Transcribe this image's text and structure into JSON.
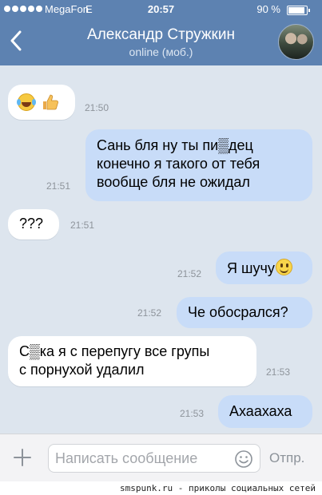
{
  "status_bar": {
    "carrier": "MegaFon",
    "network": "E",
    "time": "20:57",
    "battery": "90 %",
    "battery_level": 0.9
  },
  "header": {
    "contact_name": "Александр Стружкин",
    "status": "online (моб.)",
    "back_icon": "chevron-left-icon",
    "avatar_icon": "avatar"
  },
  "messages": [
    {
      "direction": "in",
      "text": "",
      "emoji": [
        "face-with-tears-of-joy-icon",
        "thumbs-up-icon"
      ],
      "time": "21:50"
    },
    {
      "direction": "out",
      "lines": [
        "Сань бля ну ты пи▒дец",
        "конечно я такого от тебя",
        "вообще бля не ожидал"
      ],
      "time": "21:51"
    },
    {
      "direction": "in",
      "text": "???",
      "time": "21:51"
    },
    {
      "direction": "out",
      "text": "Я шучу",
      "emoji": [
        "smiling-face-icon"
      ],
      "time": "21:52"
    },
    {
      "direction": "out",
      "text": "Че обосрался?",
      "time": "21:52"
    },
    {
      "direction": "in",
      "lines": [
        "С▒ка я с перепугу все групы",
        "с порнухой удалил"
      ],
      "time": "21:53"
    },
    {
      "direction": "out",
      "text": "Ахаахаха",
      "time": "21:53"
    }
  ],
  "composer": {
    "placeholder": "Написать сообщение",
    "send_label": "Отпр.",
    "attach_icon": "plus-icon",
    "emoji_icon": "smiley-icon"
  },
  "watermark": "smspunk.ru - приколы социальных сетей",
  "colors": {
    "header_bg": "#5d82b1",
    "chat_bg": "#dde5ee",
    "incoming_bubble": "#ffffff",
    "outgoing_bubble": "#c8dcf8"
  }
}
